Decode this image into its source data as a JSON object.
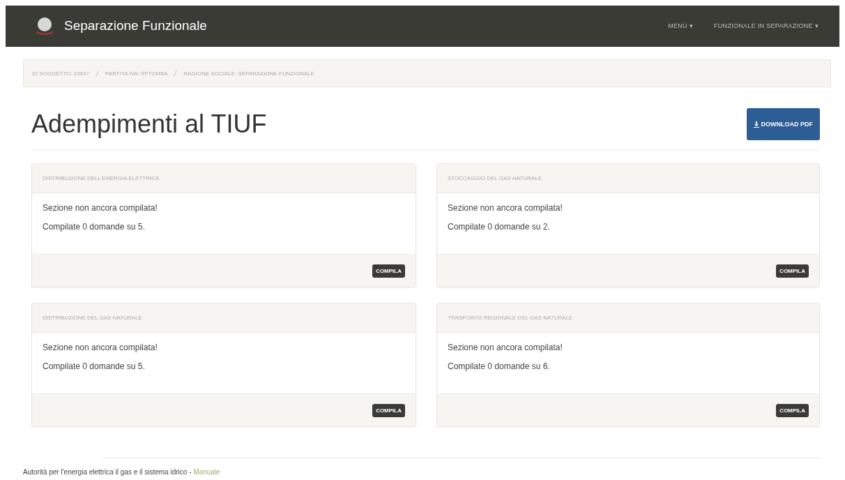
{
  "navbar": {
    "brand": "Separazione Funzionale",
    "menus": [
      {
        "label": "MENÙ",
        "caret": "▾"
      },
      {
        "label": "FUNZIONALE IN SEPARAZIONE",
        "caret": "▾"
      }
    ]
  },
  "breadcrumb": [
    "ID SOGGETTO: 24637",
    "PARTITA IVA: SP72345A",
    "RAGIONE SOCIALE: SEPARAZIONE FUNZIONALE"
  ],
  "page_title": "Adempimenti al TIUF",
  "download_button": {
    "label": "DOWNLOAD PDF"
  },
  "cards": [
    {
      "title": "DISTRIBUZIONE DELL'ENERGIA ELETTRICA",
      "status": "Sezione non ancora compilata!",
      "progress": "Compilate 0 domande su 5.",
      "button": "COMPILA"
    },
    {
      "title": "STOCCAGGIO DEL GAS NATURALE",
      "status": "Sezione non ancora compilata!",
      "progress": "Compilate 0 domande su 2.",
      "button": "COMPILA"
    },
    {
      "title": "DISTRIBUZIONE DEL GAS NATURALE",
      "status": "Sezione non ancora compilata!",
      "progress": "Compilate 0 domande su 5.",
      "button": "COMPILA"
    },
    {
      "title": "TRASPORTO REGIONALE DEL GAS NATURALE",
      "status": "Sezione non ancora compilata!",
      "progress": "Compilate 0 domande su 6.",
      "button": "COMPILA"
    }
  ],
  "footer": {
    "text": "Autorità per l'energia elettrica il gas e il sistema idrico - ",
    "link": "Manuale"
  }
}
